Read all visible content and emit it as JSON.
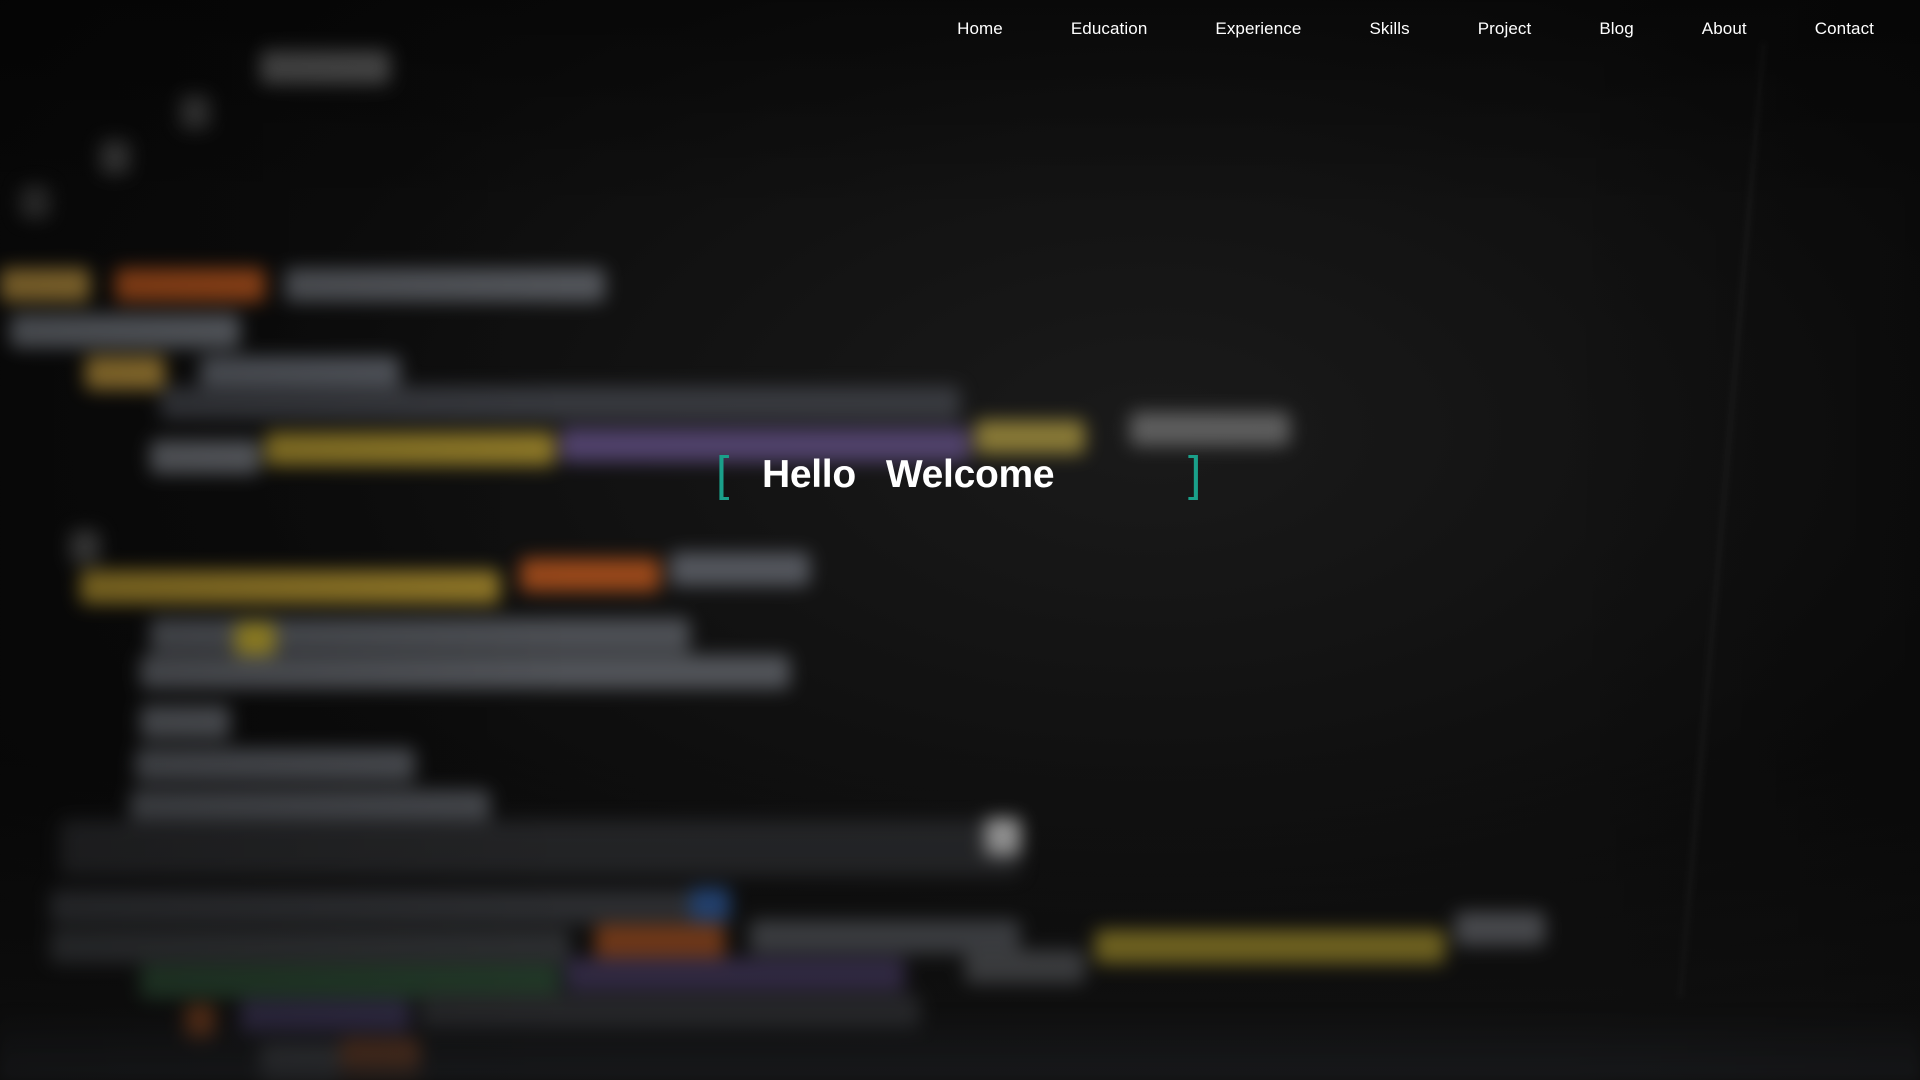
{
  "nav": {
    "items": [
      {
        "label": "Home"
      },
      {
        "label": "Education"
      },
      {
        "label": "Experience"
      },
      {
        "label": "Skills"
      },
      {
        "label": "Project"
      },
      {
        "label": "Blog"
      },
      {
        "label": "About"
      },
      {
        "label": "Contact"
      }
    ]
  },
  "hero": {
    "bracket_open": "[",
    "word1": "Hello",
    "word2": "Welcome",
    "bracket_close": "]"
  },
  "colors": {
    "accent": "#1aa08a",
    "text": "#ffffff",
    "background": "#0b0b0b"
  }
}
